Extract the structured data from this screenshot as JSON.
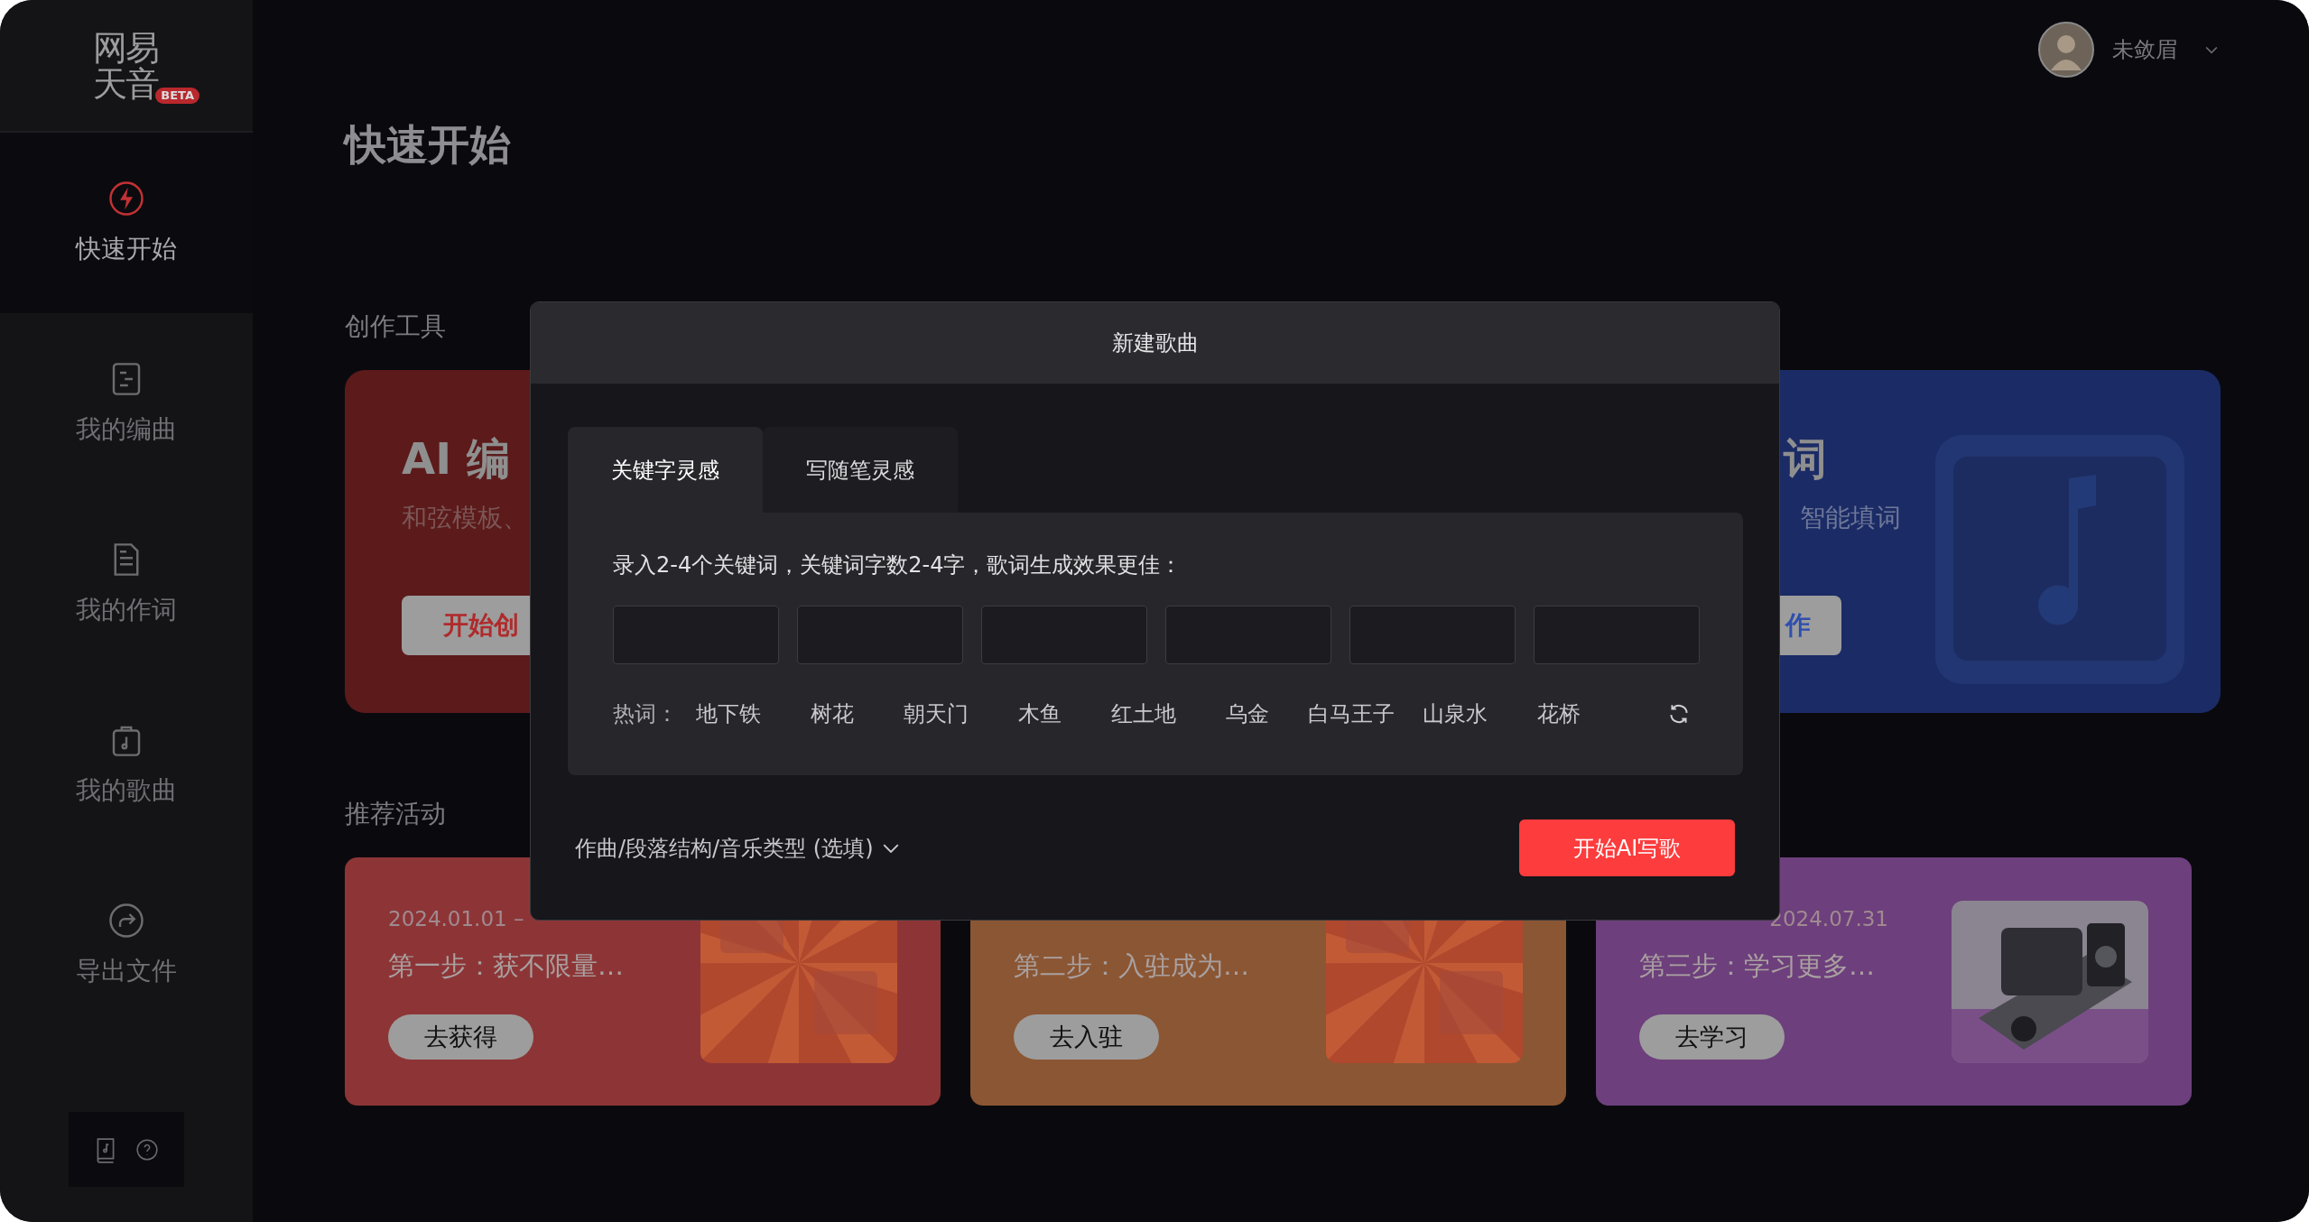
{
  "sidebar": {
    "logo": {
      "lines": [
        "网易",
        "天音"
      ],
      "badge": "BETA"
    },
    "items": [
      {
        "label": "快速开始",
        "selected": true
      },
      {
        "label": "我的编曲",
        "selected": false
      },
      {
        "label": "我的作词",
        "selected": false
      },
      {
        "label": "我的歌曲",
        "selected": false
      },
      {
        "label": "导出文件",
        "selected": false
      }
    ]
  },
  "user": {
    "name": "未敛眉"
  },
  "page_title": "快速开始",
  "tools": {
    "heading": "创作工具",
    "cards": [
      {
        "kind": "cut_end",
        "title": "AI 编",
        "subtitle": "和弦模板、",
        "button": "开始创",
        "color": "#5c1a1b"
      },
      {
        "kind": "cut_start",
        "title": "词",
        "subtitle": "智能填词",
        "button": "作",
        "color": "#1b2b66"
      }
    ]
  },
  "activities": {
    "heading": "推荐活动",
    "cards": [
      {
        "date": "2024.01.01 –",
        "text": "第一步：获不限量…",
        "button": "去获得",
        "color": "#8d3536",
        "kind": "poster"
      },
      {
        "text": "第二步：入驻成为…",
        "button": "去入驻",
        "color": "#8b5633",
        "kind": "poster"
      },
      {
        "date": "2024.07.31",
        "date_clipped": true,
        "text": "第三步：学习更多…",
        "button": "去学习",
        "color": "#6d3f7c",
        "kind": "device"
      }
    ]
  },
  "modal": {
    "title": "新建歌曲",
    "tabs": [
      {
        "label": "关键字灵感",
        "selected": true
      },
      {
        "label": "写随笔灵感",
        "selected": false
      }
    ],
    "instruction": "录入2-4个关键词，关键词字数2-4字，歌词生成效果更佳：",
    "hot_words": {
      "label": "热词：",
      "words": [
        "地下铁",
        "树花",
        "朝天门",
        "木鱼",
        "红土地",
        "乌金",
        "白马王子",
        "山泉水",
        "花桥"
      ]
    },
    "options": {
      "label": "作曲/段落结构/音乐类型 (选填)",
      "expanded": false
    },
    "submit": "开始AI写歌"
  }
}
